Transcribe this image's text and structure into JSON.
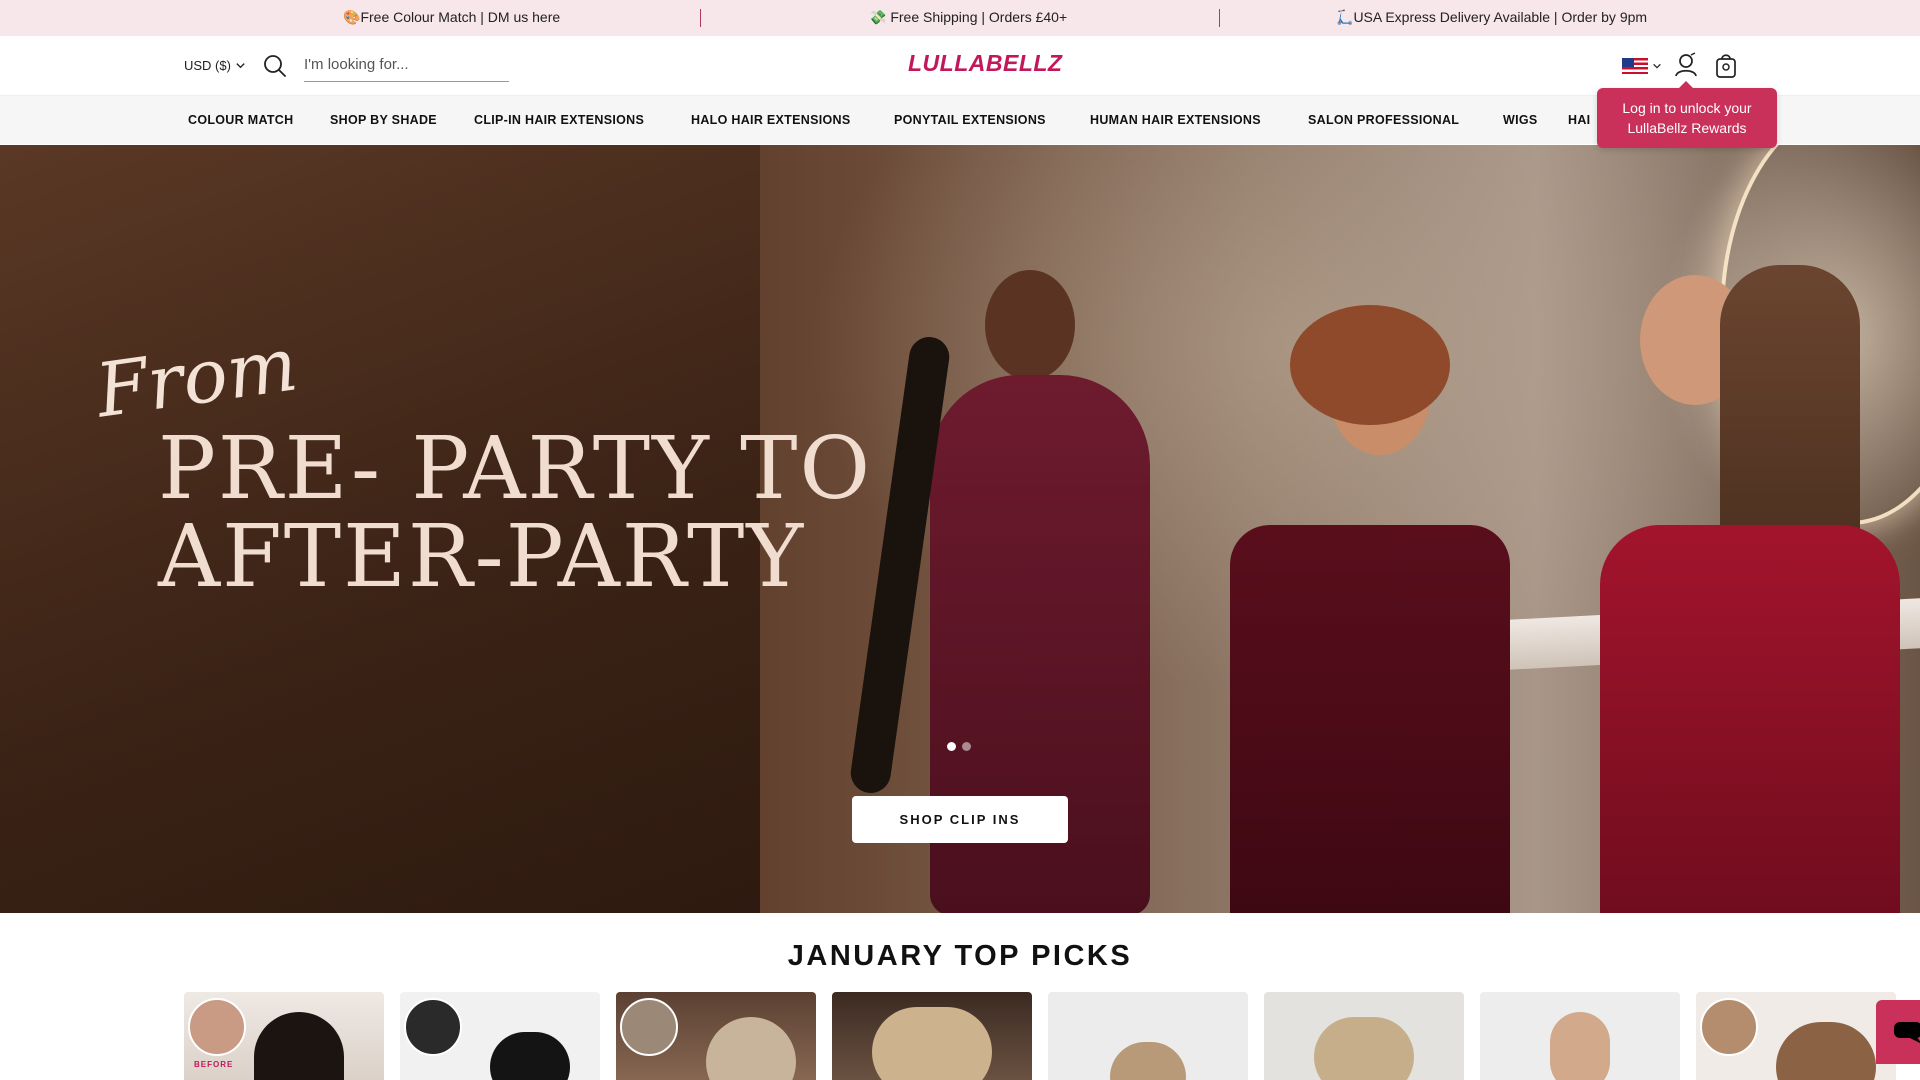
{
  "announcements": [
    {
      "icon": "🎨",
      "text": "Free Colour Match | DM us here"
    },
    {
      "icon": "💸",
      "text": " Free Shipping | Orders £40+"
    },
    {
      "icon": "🛴",
      "text": "USA Express Delivery Available | Order by 9pm"
    }
  ],
  "header": {
    "currency": "USD ($)",
    "search_placeholder": "I'm looking for...",
    "logo": "LULLABELLZ",
    "country": "United States"
  },
  "nav": {
    "items": [
      "COLOUR MATCH",
      "SHOP BY SHADE",
      "CLIP-IN HAIR EXTENSIONS",
      "HALO HAIR EXTENSIONS",
      "PONYTAIL EXTENSIONS",
      "HUMAN HAIR EXTENSIONS",
      "SALON PROFESSIONAL",
      "WIGS",
      "HAI"
    ]
  },
  "tooltip": {
    "line1": "Log in to unlock your",
    "line2": "LullaBellz Rewards"
  },
  "hero": {
    "script": "From",
    "line1": "PRE- PARTY TO",
    "line2": "AFTER-PARTY",
    "cta": "SHOP CLIP INS",
    "slides": 2,
    "active_slide": 1
  },
  "top_picks": {
    "title": "JANUARY TOP PICKS",
    "before_label": "BEFORE"
  },
  "colors": {
    "brand": "#c2185b",
    "announce_bg": "#f7e6ea",
    "tooltip_bg": "#c9305a"
  }
}
